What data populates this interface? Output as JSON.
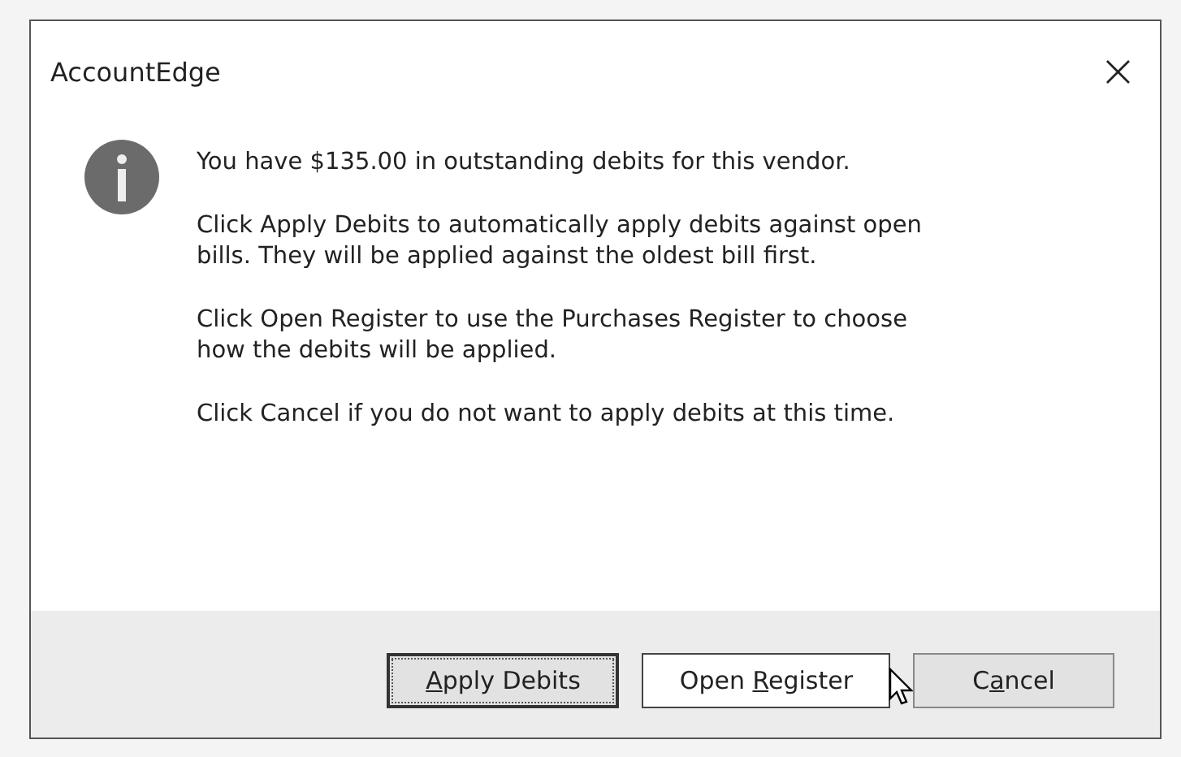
{
  "window": {
    "title": "AccountEdge",
    "close": "×"
  },
  "messages": [
    "You have $135.00 in outstanding debits for this vendor.",
    "Click Apply Debits to automatically apply debits against open bills.  They will be applied against the oldest bill first.",
    "Click Open Register to use the Purchases Register to choose how the debits will be applied.",
    "Click Cancel if you do not want to apply debits at this time."
  ],
  "buttons": [
    {
      "key": "A",
      "after": "pply Debits",
      "focused": true,
      "hovered": false
    },
    {
      "before": "Open ",
      "key": "R",
      "after": "egister",
      "focused": false,
      "hovered": true
    },
    {
      "before": "C",
      "key": "a",
      "after": "ncel",
      "focused": false,
      "hovered": false
    }
  ]
}
